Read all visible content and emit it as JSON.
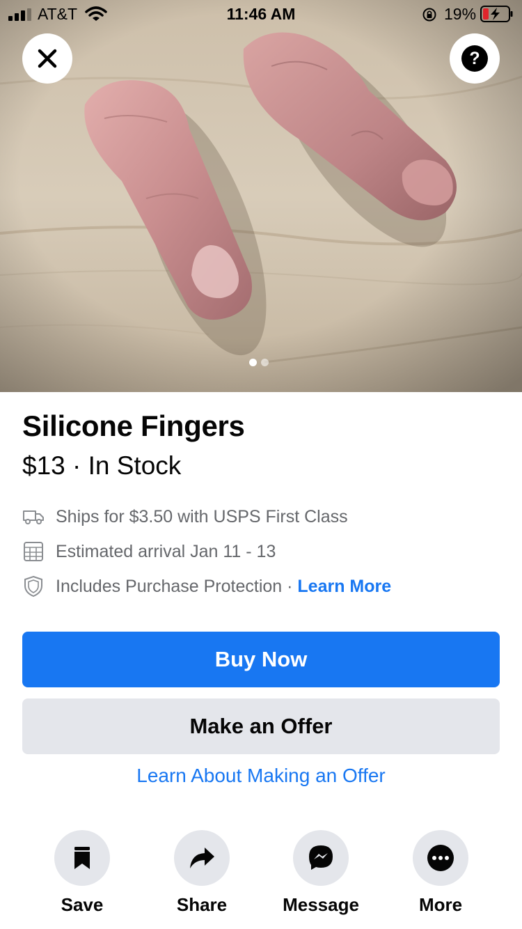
{
  "status_bar": {
    "carrier": "AT&T",
    "time": "11:46 AM",
    "battery_percent": "19%"
  },
  "photo": {
    "page_indicator": {
      "count": 2,
      "active_index": 0
    }
  },
  "overlay": {
    "close_icon": "close-icon",
    "help_icon": "help-icon",
    "help_glyph": "?"
  },
  "listing": {
    "title": "Silicone Fingers",
    "price_line": "$13 · In Stock",
    "shipping": "Ships for $3.50 with USPS First Class",
    "arrival": "Estimated arrival Jan 11 - 13",
    "protection": "Includes Purchase Protection · ",
    "learn_more": "Learn More"
  },
  "buttons": {
    "buy_now": "Buy Now",
    "make_offer": "Make an Offer",
    "offer_info_link": "Learn About Making an Offer"
  },
  "actions": [
    {
      "label": "Save",
      "icon": "bookmark-icon"
    },
    {
      "label": "Share",
      "icon": "share-arrow-icon"
    },
    {
      "label": "Message",
      "icon": "messenger-icon"
    },
    {
      "label": "More",
      "icon": "more-dots-icon"
    }
  ],
  "colors": {
    "accent": "#1877f2",
    "secondary_button": "#e4e6eb",
    "muted_text": "#65676b"
  }
}
